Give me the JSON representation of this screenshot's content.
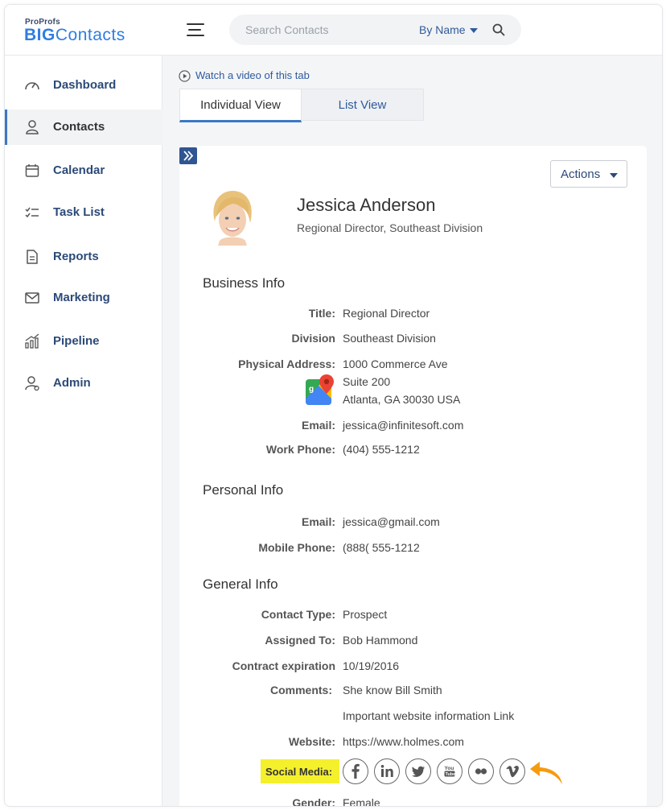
{
  "brand": {
    "top": "ProProfs",
    "big_bold": "BIG",
    "big_rest": "Contacts"
  },
  "search": {
    "placeholder": "Search Contacts",
    "mode": "By Name"
  },
  "sidebar": {
    "items": [
      {
        "label": "Dashboard",
        "icon": "dashboard-icon"
      },
      {
        "label": "Contacts",
        "icon": "user-icon",
        "active": true
      },
      {
        "label": "Calendar",
        "icon": "calendar-icon"
      },
      {
        "label": "Task List",
        "icon": "checklist-icon"
      },
      {
        "label": "Reports",
        "icon": "document-icon"
      },
      {
        "label": "Marketing",
        "icon": "envelope-icon"
      },
      {
        "label": "Pipeline",
        "icon": "bar-chart-icon"
      },
      {
        "label": "Admin",
        "icon": "admin-user-icon"
      }
    ]
  },
  "main": {
    "video_link": "Watch a video of this tab",
    "tabs": [
      {
        "label": "Individual View"
      },
      {
        "label": "List View"
      }
    ],
    "actions_label": "Actions",
    "contact": {
      "name": "Jessica Anderson",
      "subtitle": "Regional Director, Southeast Division"
    },
    "business": {
      "heading": "Business Info",
      "title_label": "Title:",
      "title": "Regional Director",
      "division_label": "Division",
      "division": "Southeast Division",
      "address_label": "Physical Address:",
      "address": [
        "1000 Commerce Ave",
        "Suite 200",
        "Atlanta, GA 30030 USA"
      ],
      "email_label": "Email:",
      "email": "jessica@infinitesoft.com",
      "phone_label": "Work Phone:",
      "phone": "(404) 555-1212"
    },
    "personal": {
      "heading": "Personal Info",
      "email_label": "Email:",
      "email": "jessica@gmail.com",
      "mobile_label": "Mobile Phone:",
      "mobile": "(888( 555-1212"
    },
    "general": {
      "heading": "General Info",
      "type_label": "Contact Type:",
      "type": "Prospect",
      "assigned_label": "Assigned To:",
      "assigned": "Bob Hammond",
      "contract_label": "Contract expiration",
      "contract": "10/19/2016",
      "comments_label": "Comments:",
      "comments": [
        "She know Bill Smith",
        "Important website information Link"
      ],
      "website_label": "Website:",
      "website": "https://www.holmes.com",
      "social_label": "Social Media:",
      "social_icons": [
        "facebook-icon",
        "linkedin-icon",
        "twitter-icon",
        "youtube-icon",
        "flickr-icon",
        "vimeo-icon"
      ],
      "gender_label": "Gender:",
      "gender": "Female"
    }
  },
  "colors": {
    "accent": "#3b78c4",
    "nav_text": "#2c4a78",
    "highlight": "#f5f02c",
    "arrow": "#f39c12"
  }
}
